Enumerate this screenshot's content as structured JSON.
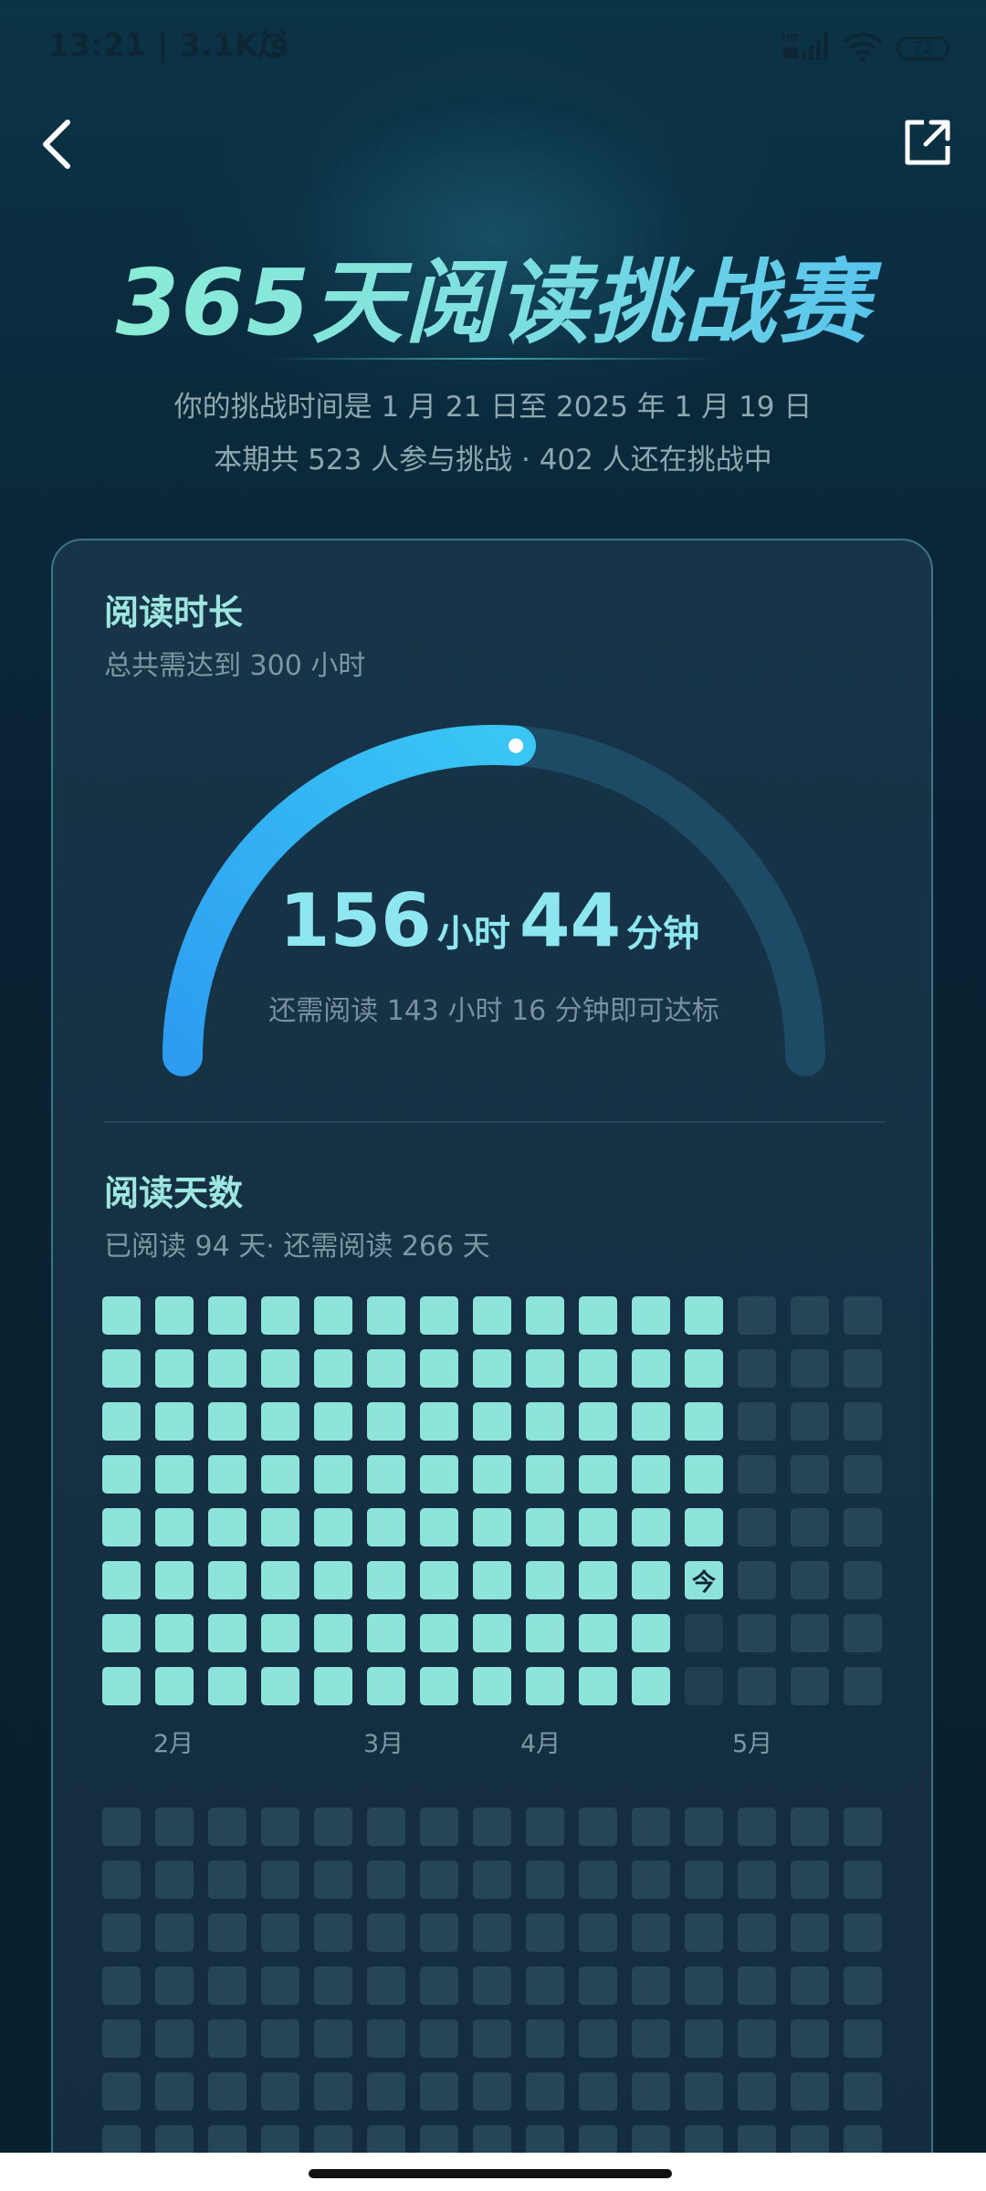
{
  "status_bar": {
    "time_speed": "13:21 | 3.1K/s",
    "network": "HD",
    "battery": "72"
  },
  "nav": {
    "back_icon": "chevron-left-icon",
    "share_icon": "share-external-icon"
  },
  "hero": {
    "title": "365天阅读挑战赛",
    "period_text": "你的挑战时间是 1 月 21 日至 2025 年 1 月 19 日",
    "participants_text": "本期共 523  人参与挑战 · 402  人还在挑战中"
  },
  "reading_time": {
    "title": "阅读时长",
    "subtitle": "总共需达到 300 小时",
    "hours": "156",
    "hours_unit": "小时",
    "minutes": "44",
    "minutes_unit": "分钟",
    "remaining": "还需阅读 143 小时 16 分钟即可达标",
    "progress_fraction": 0.5225,
    "colors": {
      "progress": "#2fa8f0",
      "track": "#1d4a64"
    }
  },
  "reading_days": {
    "title": "阅读天数",
    "subtitle": "已阅读 94 天· 还需阅读 266 天",
    "today_label": "今",
    "months": [
      "2月",
      "3月",
      "4月",
      "5月"
    ],
    "colors": {
      "read": "#8ee3da",
      "unread": "#264557"
    }
  }
}
